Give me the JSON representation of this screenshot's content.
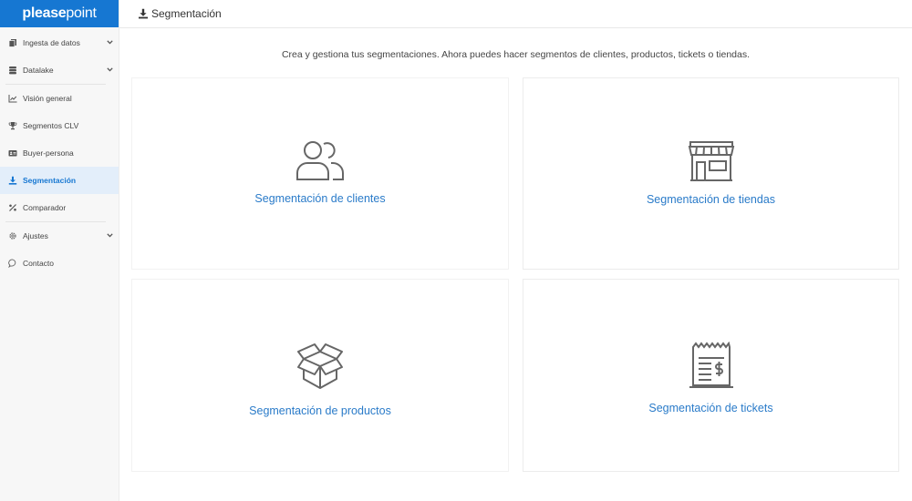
{
  "brand": {
    "part1": "please",
    "part2": "point"
  },
  "sidebar": {
    "items": [
      {
        "label": "Ingesta de datos",
        "icon": "files-icon",
        "has_chevron": true
      },
      {
        "label": "Datalake",
        "icon": "database-icon",
        "has_chevron": true
      },
      {
        "label": "Visión general",
        "icon": "line-chart-icon"
      },
      {
        "label": "Segmentos CLV",
        "icon": "trophy-icon"
      },
      {
        "label": "Buyer-persona",
        "icon": "id-card-icon"
      },
      {
        "label": "Segmentación",
        "icon": "download-icon",
        "active": true
      },
      {
        "label": "Comparador",
        "icon": "percent-icon"
      },
      {
        "label": "Ajustes",
        "icon": "gear-icon",
        "has_chevron": true
      },
      {
        "label": "Contacto",
        "icon": "chat-bubble-icon"
      }
    ]
  },
  "header": {
    "title": "Segmentación",
    "icon": "download-icon"
  },
  "main": {
    "intro": "Crea y gestiona tus segmentaciones. Ahora puedes hacer segmentos de clientes, productos, tickets o tiendas.",
    "cards": [
      {
        "label": "Segmentación de clientes",
        "icon": "users-icon"
      },
      {
        "label": "Segmentación de tiendas",
        "icon": "store-icon"
      },
      {
        "label": "Segmentación de productos",
        "icon": "box-icon"
      },
      {
        "label": "Segmentación de tickets",
        "icon": "receipt-icon"
      }
    ]
  },
  "colors": {
    "brand": "#1677d2",
    "link": "#2a7bc9",
    "active_bg": "#e3eefa"
  }
}
